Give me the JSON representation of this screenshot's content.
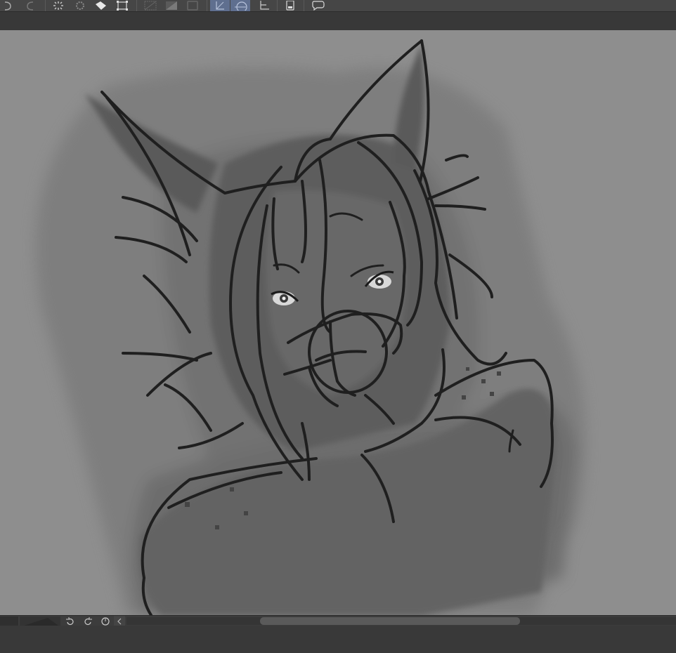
{
  "toolbar": {
    "buttons": [
      {
        "icon": "undo-icon"
      },
      {
        "icon": "redo-icon"
      },
      {
        "icon": "loading-spinner-icon"
      },
      {
        "icon": "settings-gear-icon"
      },
      {
        "icon": "fill-bucket-icon"
      },
      {
        "icon": "transform-icon"
      },
      {
        "icon": "selection-clear-icon"
      },
      {
        "icon": "selection-invert-icon"
      },
      {
        "icon": "layer-box-icon"
      },
      {
        "icon": "ruler-snap-icon"
      },
      {
        "icon": "curve-snap-icon"
      },
      {
        "icon": "grid-icon"
      },
      {
        "icon": "device-icon"
      },
      {
        "icon": "feedback-icon"
      }
    ]
  },
  "navigator": {
    "buttons": [
      {
        "icon": "rotate-left-icon"
      },
      {
        "icon": "rotate-right-icon"
      },
      {
        "icon": "reset-rotation-icon"
      },
      {
        "icon": "scroll-left-icon"
      }
    ],
    "scroll_position": 0.46
  },
  "colors": {
    "canvas_bg": "#8e8e8e",
    "ui_dark": "#3b3b3b",
    "active_button": "#5f6f8f",
    "ink": "#1f1f1f"
  }
}
